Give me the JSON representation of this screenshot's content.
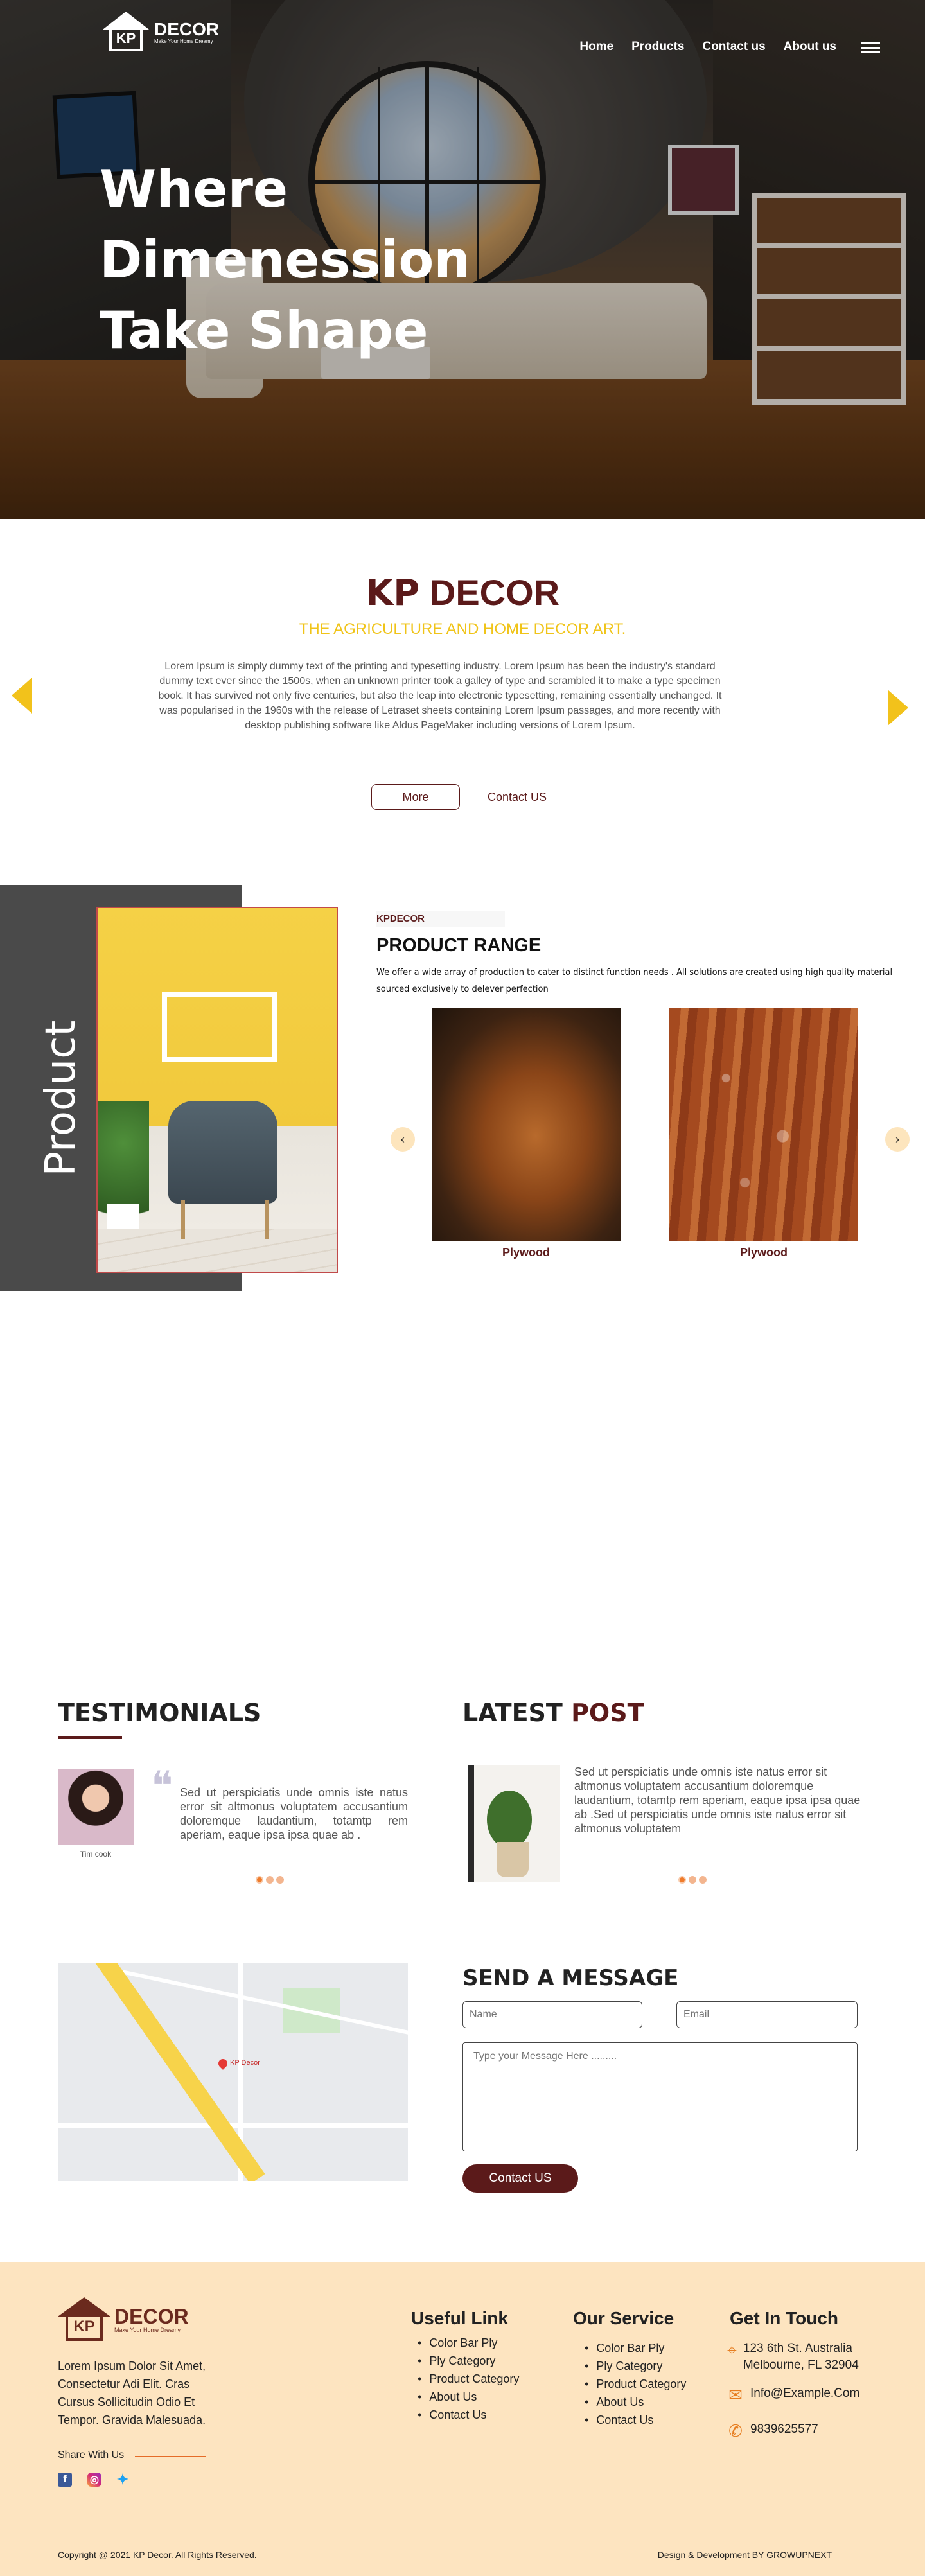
{
  "brand": {
    "logo_text": "DECOR",
    "logo_mark": "KP",
    "tagline": "Make Your Home Dreamy"
  },
  "nav": {
    "items": [
      "Home",
      "Products",
      "Contact us",
      "About us"
    ]
  },
  "hero": {
    "title": "Where Dimenession Take Shape"
  },
  "about": {
    "title_kp": "KP",
    "title_rest": "DECOR",
    "subtitle": "THE AGRICULTURE AND HOME DECOR ART.",
    "paragraph": "Lorem Ipsum is simply dummy text of the printing and typesetting industry. Lorem Ipsum has been the industry's standard dummy text ever since the 1500s, when an unknown printer took a galley of type and scrambled it to make a type specimen book. It has survived not only five centuries, but also the leap into electronic typesetting, remaining essentially unchanged. It was popularised in the 1960s with the release of Letraset sheets containing Lorem Ipsum passages, and more recently with desktop publishing software like Aldus PageMaker including versions of Lorem Ipsum.",
    "more_label": "More",
    "contact_label": "Contact US"
  },
  "product": {
    "side_label": "Product",
    "kicker": "KPDECOR",
    "title": "PRODUCT RANGE",
    "description": "We offer a wide array of production to cater to distinct function needs . All solutions are created using high quality material sourced exclusively to delever perfection",
    "cards": [
      {
        "label": "Plywood"
      },
      {
        "label": "Plywood"
      }
    ],
    "prev_icon": "‹",
    "next_icon": "›"
  },
  "testimonials": {
    "title": "TESTIMONIALS",
    "name": "Tim cook",
    "quote_mark": "❝",
    "text": "Sed ut perspiciatis unde omnis iste natus error sit altmonus voluptatem accusantium doloremque laudantium, totamtp rem aperiam, eaque ipsa ipsa quae ab ."
  },
  "latest_post": {
    "title_a": "LATEST",
    "title_b": "POST",
    "text": "Sed ut perspiciatis unde omnis iste natus error sit altmonus voluptatem accusantium doloremque laudantium, totamtp rem aperiam, eaque ipsa ipsa quae ab .Sed ut perspiciatis unde omnis iste natus error sit altmonus voluptatem"
  },
  "map": {
    "pin_label": "KP Decor"
  },
  "form": {
    "title": "SEND A MESSAGE",
    "name_placeholder": "Name",
    "email_placeholder": "Email",
    "message_placeholder": "Type your Message Here .........",
    "submit_label": "Contact US"
  },
  "footer": {
    "about": "Lorem Ipsum Dolor Sit Amet, Consectetur Adi Elit. Cras Cursus Sollicitudin Odio Et Tempor. Gravida Malesuada.",
    "share_label": "Share With Us",
    "useful_title": "Useful Link",
    "useful_links": [
      "Color Bar Ply",
      "Ply Category",
      "Product Category",
      "About Us",
      "Contact Us"
    ],
    "service_title": "Our Service",
    "service_links": [
      "Color Bar Ply",
      "Ply Category",
      "Product Category",
      "About Us",
      "Contact Us"
    ],
    "touch_title": "Get In Touch",
    "address": "123 6th St. Australia Melbourne, FL 32904",
    "email": "Info@Example.Com",
    "phone": "9839625577",
    "copyright": "Copyright @ 2021 KP Decor. All Rights Reserved.",
    "credit": "Design & Development BY GROWUPNEXT"
  },
  "colors": {
    "brand": "#5b1a1a",
    "accent_yellow": "#f2c21b",
    "footer_bg": "#fde4c0",
    "dot_active": "#ef7b2b"
  },
  "icons": [
    "menu-icon",
    "arrow-left-icon",
    "arrow-right-icon",
    "quote-icon",
    "location-icon",
    "mail-icon",
    "phone-icon",
    "facebook-icon",
    "instagram-icon",
    "twitter-icon"
  ]
}
